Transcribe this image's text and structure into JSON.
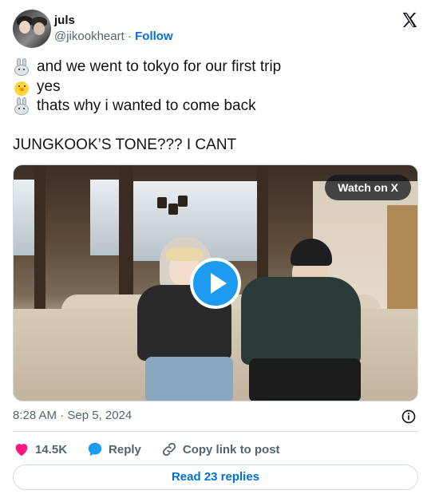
{
  "author": {
    "name": "juls",
    "handle": "@jikookheart",
    "separator": "·",
    "follow_label": "Follow"
  },
  "tweet": {
    "lines": [
      {
        "emoji": "rabbit-emoji",
        "text": "and we went to tokyo for our first trip"
      },
      {
        "emoji": "chick-emoji",
        "text": "yes"
      },
      {
        "emoji": "rabbit-emoji",
        "text": "thats why i wanted to come back"
      }
    ],
    "caption": "JUNGKOOK’S TONE??? I CANT"
  },
  "media": {
    "watch_label": "Watch on X",
    "play_icon": "play-icon"
  },
  "meta": {
    "timestamp": "8:28 AM · Sep 5, 2024"
  },
  "actions": {
    "likes": "14.5K",
    "reply_label": "Reply",
    "copy_label": "Copy link to post"
  },
  "footer": {
    "read_label": "Read 23 replies"
  },
  "colors": {
    "accent": "#1d9bf0",
    "link": "#006fd6",
    "like": "#f91880",
    "muted": "#536471"
  }
}
